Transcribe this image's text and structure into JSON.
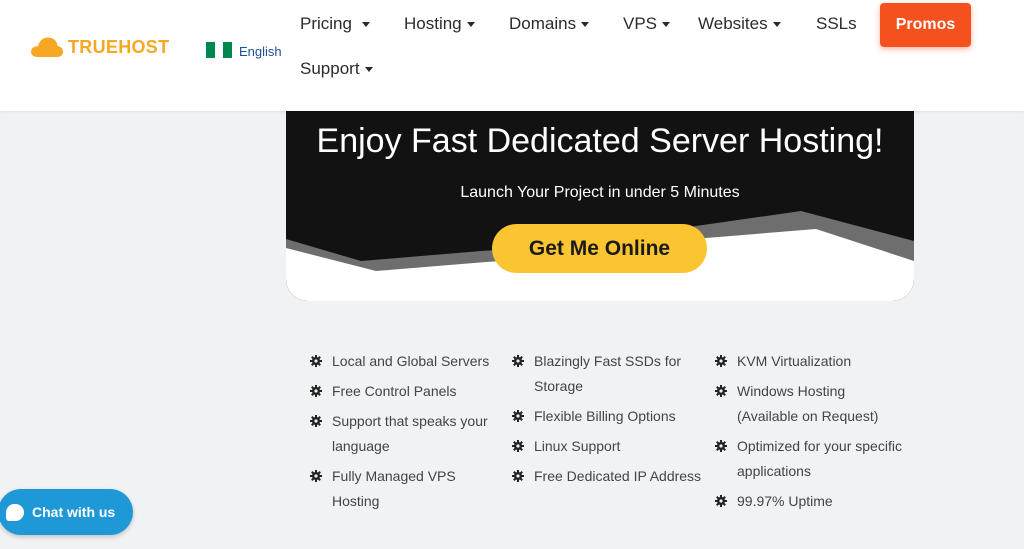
{
  "brand": {
    "name": "TRUEHOST",
    "color": "#f7a823"
  },
  "language": {
    "label": "English",
    "flag_colors": [
      "#008751",
      "#ffffff",
      "#008751"
    ]
  },
  "nav": {
    "pricing": "Pricing",
    "hosting": "Hosting",
    "domains": "Domains",
    "vps": "VPS",
    "websites": "Websites",
    "ssls": "SSLs",
    "support": "Support",
    "promos": "Promos"
  },
  "hero": {
    "title": "Enjoy Fast Dedicated Server Hosting!",
    "subtitle": "Launch Your Project in under 5 Minutes",
    "cta": "Get Me Online",
    "cta_color": "#fbc532"
  },
  "features": {
    "col1": [
      "Local and Global Servers",
      "Free Control Panels",
      "Support that speaks your language",
      "Fully Managed VPS Hosting"
    ],
    "col2": [
      "Blazingly Fast SSDs for Storage",
      "Flexible Billing Options",
      "Linux Support",
      "Free Dedicated IP Address"
    ],
    "col3": [
      "KVM Virtualization",
      "Windows Hosting (Available on Request)",
      "Optimized for your specific applications",
      "99.97% Uptime"
    ]
  },
  "chat": {
    "label": "Chat with us",
    "color": "#1e98d7"
  }
}
